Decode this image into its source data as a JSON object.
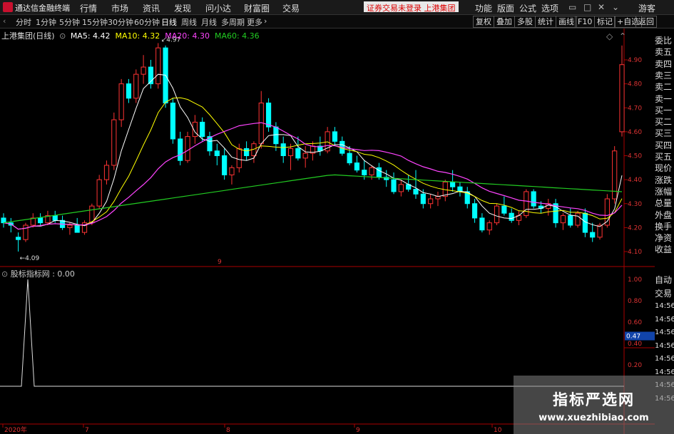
{
  "app": {
    "title": "通达信金融终端",
    "menus": [
      "行情",
      "市场",
      "资讯",
      "发现",
      "问小达",
      "财富圈",
      "交易"
    ],
    "trade_status": "证券交易未登录  上港集团",
    "right_menus": [
      "功能",
      "版面",
      "公式",
      "选项"
    ],
    "user": "游客"
  },
  "toolbar": {
    "periods": [
      "分时",
      "1分钟",
      "5分钟",
      "15分钟",
      "30分钟",
      "60分钟",
      "日线",
      "周线",
      "月线",
      "多周期",
      "更多"
    ],
    "active_period": "日线",
    "right_buttons": [
      "复权",
      "叠加",
      "多股",
      "统计",
      "画线",
      "F10",
      "标记",
      "+自选",
      "返回"
    ]
  },
  "price_panel": {
    "stock": "上港集团(日线)",
    "ma_labels": [
      {
        "text": "MA5: 4.42",
        "color": "#ffffff"
      },
      {
        "text": "MA10: 4.32",
        "color": "#ffff00"
      },
      {
        "text": "MA20: 4.30",
        "color": "#ff44ff"
      },
      {
        "text": "MA60: 4.36",
        "color": "#22cc22"
      }
    ],
    "high_label": "4.97",
    "low_label": "4.09",
    "y_ticks": [
      "4.90",
      "4.80",
      "4.70",
      "4.60",
      "4.50",
      "4.40",
      "4.30",
      "4.20",
      "4.10"
    ],
    "marker": "9"
  },
  "indicator_panel": {
    "label": "股标指标网 : 0.00",
    "y_ticks": [
      "1.00",
      "0.80",
      "0.60",
      "0.47",
      "0.40",
      "0.20"
    ],
    "current_value": "0.47"
  },
  "x_axis": {
    "labels": [
      "2020年",
      "7",
      "8",
      "9",
      "10"
    ]
  },
  "side_panel": {
    "items": [
      "委比",
      "卖五",
      "卖四",
      "卖三",
      "卖二",
      "卖一",
      "买一",
      "买二",
      "买三",
      "买四",
      "买五",
      "现价",
      "涨跌",
      "涨幅",
      "总量",
      "外盘",
      "换手",
      "净资",
      "收益"
    ],
    "lower_items": [
      "自动",
      "交易",
      "14:56",
      "14:56",
      "14:56",
      "14:56",
      "14:56",
      "14:56",
      "14:56",
      "14:56"
    ]
  },
  "watermark": {
    "title": "指标严选网",
    "url": "www.xuezhibiao.com"
  },
  "colors": {
    "up": "#ff3333",
    "down": "#00ffff",
    "ma5": "#ffffff",
    "ma10": "#ffff00",
    "ma20": "#ff44ff",
    "ma60": "#22cc22"
  }
}
